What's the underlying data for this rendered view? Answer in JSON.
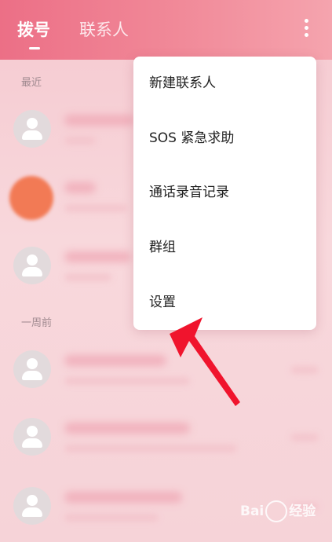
{
  "header": {
    "tabs": [
      {
        "label": "拨号",
        "active": true
      },
      {
        "label": "联系人",
        "active": false
      }
    ],
    "more_icon": "more-vertical-icon"
  },
  "list": {
    "sections": [
      {
        "label": "最近"
      },
      {
        "label": "一周前"
      }
    ]
  },
  "menu": {
    "items": [
      {
        "label": "新建联系人"
      },
      {
        "label": "SOS 紧急求助"
      },
      {
        "label": "通话录音记录"
      },
      {
        "label": "群组"
      },
      {
        "label": "设置"
      }
    ]
  },
  "annotation": {
    "arrow_color": "#f0142d",
    "target": "设置"
  },
  "watermark": {
    "text_left": "Bai",
    "text_right": "经验"
  },
  "colors": {
    "header_start": "#ec6f86",
    "header_end": "#f5a4ae",
    "accent": "#f0142d"
  }
}
